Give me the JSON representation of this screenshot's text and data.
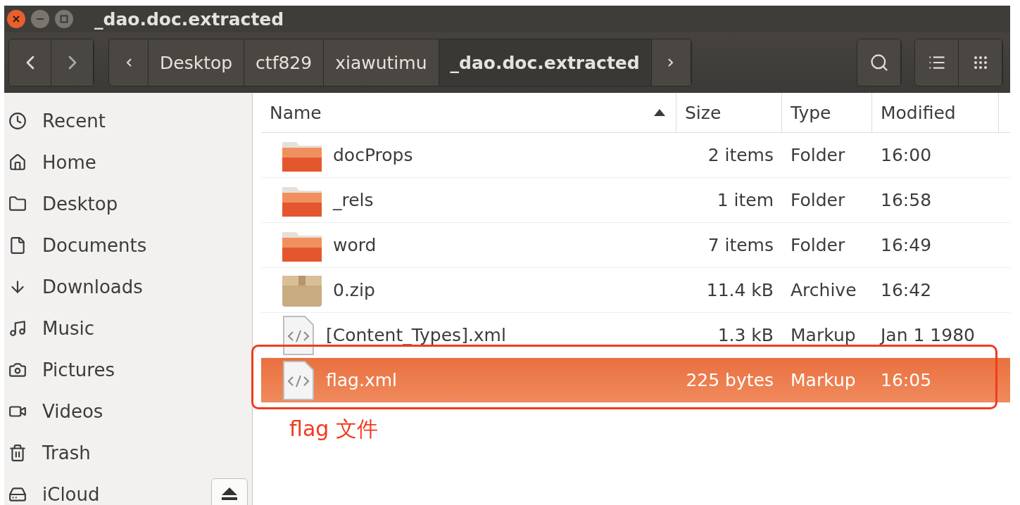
{
  "window": {
    "title": "_dao.doc.extracted"
  },
  "breadcrumbs": [
    {
      "label": "Desktop",
      "selected": false
    },
    {
      "label": "ctf829",
      "selected": false
    },
    {
      "label": "xiawutimu",
      "selected": false
    },
    {
      "label": "_dao.doc.extracted",
      "selected": true
    }
  ],
  "sidebar": {
    "items": [
      {
        "label": "Recent",
        "kind": "recent"
      },
      {
        "label": "Home",
        "kind": "home"
      },
      {
        "label": "Desktop",
        "kind": "desktop"
      },
      {
        "label": "Documents",
        "kind": "documents"
      },
      {
        "label": "Downloads",
        "kind": "downloads"
      },
      {
        "label": "Music",
        "kind": "music"
      },
      {
        "label": "Pictures",
        "kind": "pictures"
      },
      {
        "label": "Videos",
        "kind": "videos"
      },
      {
        "label": "Trash",
        "kind": "trash"
      },
      {
        "label": "iCloud",
        "kind": "drive"
      }
    ]
  },
  "table": {
    "columns": [
      "Name",
      "Size",
      "Type",
      "Modified"
    ],
    "rows": [
      {
        "name": "docProps",
        "size": "2 items",
        "type": "Folder",
        "modified": "16:00",
        "kind": "folder",
        "selected": false
      },
      {
        "name": "_rels",
        "size": "1 item",
        "type": "Folder",
        "modified": "16:58",
        "kind": "folder",
        "selected": false
      },
      {
        "name": "word",
        "size": "7 items",
        "type": "Folder",
        "modified": "16:49",
        "kind": "folder",
        "selected": false
      },
      {
        "name": "0.zip",
        "size": "11.4 kB",
        "type": "Archive",
        "modified": "16:42",
        "kind": "archive",
        "selected": false
      },
      {
        "name": "[Content_Types].xml",
        "size": "1.3 kB",
        "type": "Markup",
        "modified": "Jan 1 1980",
        "kind": "markup",
        "selected": false
      },
      {
        "name": "flag.xml",
        "size": "225 bytes",
        "type": "Markup",
        "modified": "16:05",
        "kind": "markup",
        "selected": true
      }
    ]
  },
  "annotation": {
    "text": "flag 文件"
  }
}
